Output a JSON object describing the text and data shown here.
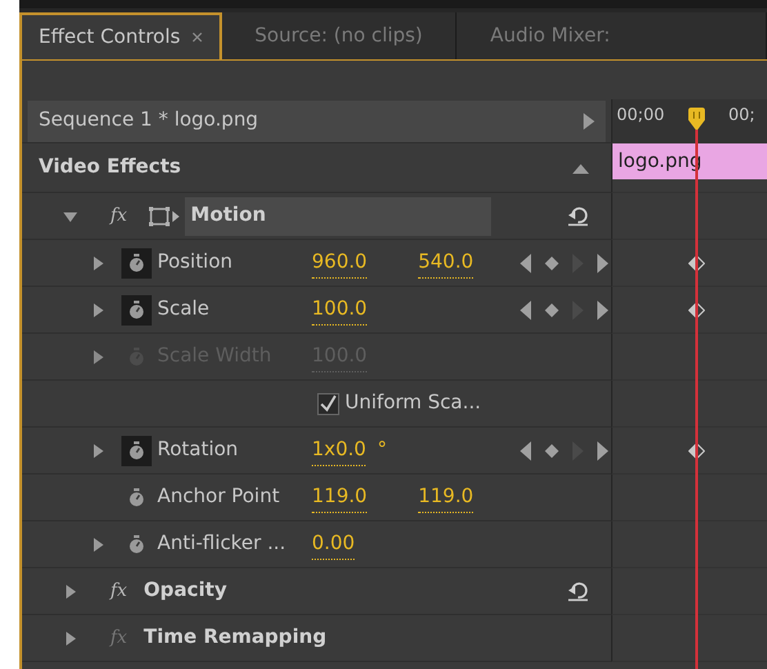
{
  "tabs": [
    {
      "label": "Effect Controls",
      "selected": true,
      "closable": true
    },
    {
      "label": "Source: (no clips)",
      "selected": false,
      "closable": false
    },
    {
      "label": "Audio Mixer:",
      "selected": false,
      "closable": false
    }
  ],
  "sequence_label": "Sequence 1 * logo.png",
  "timeline": {
    "time_labels": [
      "00;00",
      "00;"
    ],
    "clip_label": "logo.png"
  },
  "section": {
    "title": "Video Effects",
    "expanded": true
  },
  "effects": [
    {
      "kind": "motion",
      "fx": "fx",
      "fx_enabled": true,
      "name": "Motion",
      "expanded": true,
      "resettable": true,
      "properties": [
        {
          "kind": "param",
          "name": "Position",
          "values": [
            "960.0",
            "540.0"
          ],
          "animated": true,
          "disabled": false,
          "expandable": true
        },
        {
          "kind": "param",
          "name": "Scale",
          "values": [
            "100.0"
          ],
          "animated": true,
          "disabled": false,
          "expandable": true
        },
        {
          "kind": "param",
          "name": "Scale Width",
          "values": [
            "100.0"
          ],
          "animated": false,
          "disabled": true,
          "expandable": true
        },
        {
          "kind": "checkbox",
          "label": "Uniform Sca...",
          "checked": true
        },
        {
          "kind": "param",
          "name": "Rotation",
          "values": [
            "1x0.0"
          ],
          "unit": "°",
          "animated": true,
          "disabled": false,
          "expandable": true
        },
        {
          "kind": "param",
          "name": "Anchor Point",
          "values": [
            "119.0",
            "119.0"
          ],
          "animated": false,
          "disabled": false,
          "expandable": false
        },
        {
          "kind": "param",
          "name": "Anti-flicker ...",
          "values": [
            "0.00"
          ],
          "animated": false,
          "disabled": false,
          "expandable": true
        }
      ]
    },
    {
      "kind": "standard",
      "fx": "fx",
      "fx_enabled": true,
      "name": "Opacity",
      "expanded": false,
      "resettable": true
    },
    {
      "kind": "standard",
      "fx": "fx",
      "fx_enabled": false,
      "name": "Time Remapping",
      "expanded": false,
      "resettable": false
    }
  ]
}
